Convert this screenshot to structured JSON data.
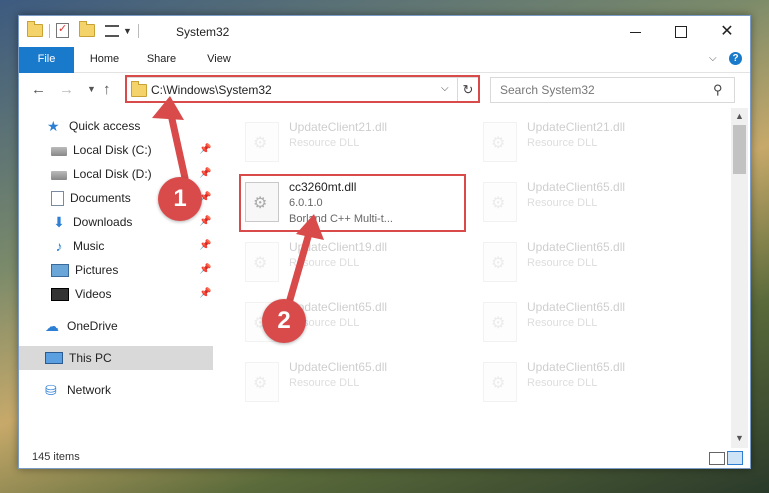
{
  "window": {
    "title": "System32",
    "min_icon": "minimize-icon",
    "max_icon": "maximize-icon",
    "close_glyph": "✕"
  },
  "ribbon": {
    "tabs": [
      {
        "label": "File"
      },
      {
        "label": "Home"
      },
      {
        "label": "Share"
      },
      {
        "label": "View"
      }
    ],
    "help_glyph": "?"
  },
  "navigation": {
    "address": "C:\\Windows\\System32",
    "search_placeholder": "Search System32"
  },
  "sidebar": {
    "items": [
      {
        "label": "Quick access",
        "icon": "star-icon"
      },
      {
        "label": "Local Disk (C:)",
        "icon": "disk-icon",
        "pinned": true
      },
      {
        "label": "Local Disk (D:)",
        "icon": "disk-icon",
        "pinned": true
      },
      {
        "label": "Documents",
        "icon": "documents-icon",
        "pinned": true
      },
      {
        "label": "Downloads",
        "icon": "download-icon",
        "pinned": true
      },
      {
        "label": "Music",
        "icon": "music-icon",
        "pinned": true
      },
      {
        "label": "Pictures",
        "icon": "pictures-icon",
        "pinned": true
      },
      {
        "label": "Videos",
        "icon": "videos-icon",
        "pinned": true
      },
      {
        "label": "OneDrive",
        "icon": "cloud-icon"
      },
      {
        "label": "This PC",
        "icon": "computer-icon",
        "selected": true
      },
      {
        "label": "Network",
        "icon": "network-icon"
      }
    ]
  },
  "files": [
    {
      "name": "UpdateClient21.dll",
      "type": "Resource DLL"
    },
    {
      "name": "UpdateClient21.dll",
      "type": "Resource DLL"
    },
    {
      "name": "cc3260mt.dll",
      "version": "6.0.1.0",
      "description": "Borland C++ Multi-t..."
    },
    {
      "name": "UpdateClient65.dll",
      "type": "Resource DLL"
    },
    {
      "name": "UpdateClient19.dll",
      "type": "Resource DLL"
    },
    {
      "name": "UpdateClient65.dll",
      "type": "Resource DLL"
    },
    {
      "name": "UpdateClient65.dll",
      "type": "Resource DLL"
    },
    {
      "name": "UpdateClient65.dll",
      "type": "Resource DLL"
    },
    {
      "name": "UpdateClient65.dll",
      "type": "Resource DLL"
    },
    {
      "name": "UpdateClient65.dll",
      "type": "Resource DLL"
    }
  ],
  "status": {
    "item_count": "145 items"
  },
  "annotations": {
    "step1": "1",
    "step2": "2",
    "highlight_color": "#d94a4a"
  },
  "colors": {
    "accent": "#1979ca",
    "selection": "#d9d9d9"
  }
}
